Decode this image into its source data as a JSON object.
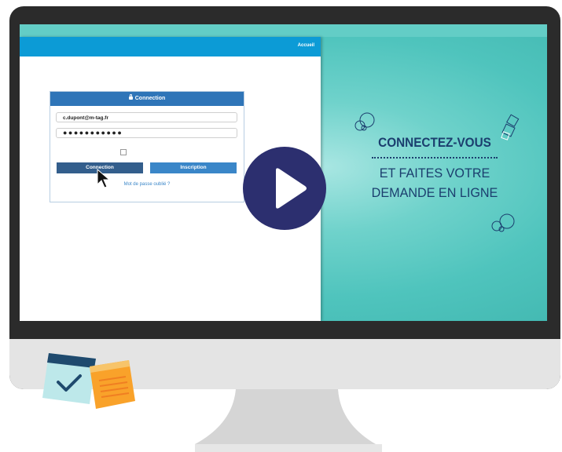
{
  "browser": {
    "nav_link": "Accueil",
    "login_panel": {
      "title": "Connection",
      "email_value": "c.dupont@m-tag.fr",
      "password_value": "●●●●●●●●●●●",
      "login_button": "Connection",
      "signup_button": "Inscription",
      "forgot_link": "Mot de passe oublié ?"
    }
  },
  "tagline": {
    "line1": "CONNECTEZ-VOUS",
    "line2": "ET FAITES VOTRE",
    "line3": "DEMANDE EN LIGNE"
  },
  "colors": {
    "screen_teal": "#4fc4bd",
    "browser_bar": "#0c9bd6",
    "panel_header": "#2f75b8",
    "play_button": "#2c2f6f",
    "tagline_text": "#1b3e6e"
  },
  "icons": [
    "lock-icon",
    "mouse-cursor-icon",
    "play-icon",
    "decorative-circles-icon",
    "decorative-diamonds-icon",
    "checklist-card-icon",
    "sticky-note-icon"
  ]
}
